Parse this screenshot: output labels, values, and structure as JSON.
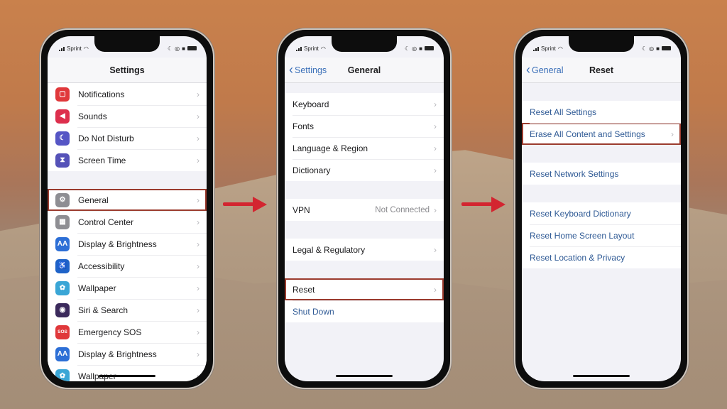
{
  "status_bar": {
    "carrier": "Sprint",
    "icons": [
      "signal-icon",
      "wifi-icon",
      "moon-icon",
      "orientation-lock-icon",
      "alarm-icon",
      "battery-icon"
    ]
  },
  "colors": {
    "highlight": "#9b3b2e",
    "arrow": "#d32530",
    "link": "#3a6fb8"
  },
  "phones": [
    {
      "title": "Settings",
      "back_label": null,
      "groups": [
        [
          {
            "label": "Notifications",
            "icon": "notifications-icon",
            "icon_color": "#e0383b",
            "glyph": "▢"
          },
          {
            "label": "Sounds",
            "icon": "speaker-icon",
            "icon_color": "#dd2f4d",
            "glyph": "◀"
          },
          {
            "label": "Do Not Disturb",
            "icon": "moon-icon",
            "icon_color": "#5656c5",
            "glyph": "☾"
          },
          {
            "label": "Screen Time",
            "icon": "hourglass-icon",
            "icon_color": "#5552b8",
            "glyph": "⧗"
          }
        ],
        [
          {
            "label": "General",
            "icon": "gear-icon",
            "icon_color": "#8e8e93",
            "glyph": "⚙",
            "highlighted": true
          },
          {
            "label": "Control Center",
            "icon": "toggles-icon",
            "icon_color": "#8e8e93",
            "glyph": "▦"
          },
          {
            "label": "Display & Brightness",
            "icon": "brightness-icon",
            "icon_color": "#2d6fd6",
            "glyph": "AA"
          },
          {
            "label": "Accessibility",
            "icon": "accessibility-icon",
            "icon_color": "#1f63c8",
            "glyph": "♿"
          },
          {
            "label": "Wallpaper",
            "icon": "wallpaper-icon",
            "icon_color": "#3aa6d6",
            "glyph": "✿"
          },
          {
            "label": "Siri & Search",
            "icon": "siri-icon",
            "icon_color": "#3b2a5c",
            "glyph": "◉"
          },
          {
            "label": "Emergency SOS",
            "icon": "sos-icon",
            "icon_color": "#e0383b",
            "glyph": "SOS"
          },
          {
            "label": "Display & Brightness",
            "icon": "brightness-icon",
            "icon_color": "#2d6fd6",
            "glyph": "AA"
          },
          {
            "label": "Wallpaper",
            "icon": "wallpaper-icon",
            "icon_color": "#3aa6d6",
            "glyph": "✿"
          }
        ]
      ]
    },
    {
      "title": "General",
      "back_label": "Settings",
      "groups": [
        [
          {
            "label": "Keyboard"
          },
          {
            "label": "Fonts"
          },
          {
            "label": "Language & Region"
          },
          {
            "label": "Dictionary"
          }
        ],
        [
          {
            "label": "VPN",
            "value": "Not Connected"
          }
        ],
        [
          {
            "label": "Legal & Regulatory"
          }
        ],
        [
          {
            "label": "Reset",
            "highlighted": true
          },
          {
            "label": "Shut Down",
            "link": true,
            "no_chevron": true
          }
        ]
      ]
    },
    {
      "title": "Reset",
      "back_label": "General",
      "groups": [
        [
          {
            "label": "Reset All Settings",
            "link": true,
            "no_chevron": true
          },
          {
            "label": "Erase All Content and Settings",
            "link": true,
            "highlighted": true
          }
        ],
        [
          {
            "label": "Reset Network Settings",
            "link": true,
            "no_chevron": true
          }
        ],
        [
          {
            "label": "Reset Keyboard Dictionary",
            "link": true,
            "no_chevron": true
          },
          {
            "label": "Reset Home Screen Layout",
            "link": true,
            "no_chevron": true
          },
          {
            "label": "Reset Location & Privacy",
            "link": true,
            "no_chevron": true
          }
        ]
      ]
    }
  ],
  "chevron_glyph": "›",
  "back_glyph": "‹"
}
